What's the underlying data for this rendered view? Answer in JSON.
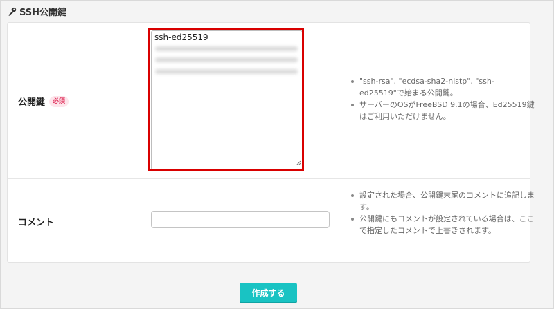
{
  "section": {
    "icon": "key-icon",
    "title": "SSH公開鍵"
  },
  "public_key": {
    "label": "公開鍵",
    "required_badge": "必須",
    "value_first_line": "ssh-ed25519",
    "notes": [
      "\"ssh-rsa\", \"ecdsa-sha2-nistp\", \"ssh-ed25519\"で始まる公開鍵。",
      "サーバーのOSがFreeBSD 9.1の場合、Ed25519鍵はご利用いただけません。"
    ]
  },
  "comment": {
    "label": "コメント",
    "value": "",
    "notes": [
      "設定された場合、公開鍵末尾のコメントに追記します。",
      "公開鍵にもコメントが設定されている場合は、ここで指定したコメントで上書きされます。"
    ]
  },
  "actions": {
    "create_label": "作成する"
  },
  "colors": {
    "button": "#19c3c3",
    "highlight": "#d90000",
    "badge_text": "#e0325d",
    "badge_bg": "#fde5eb"
  }
}
